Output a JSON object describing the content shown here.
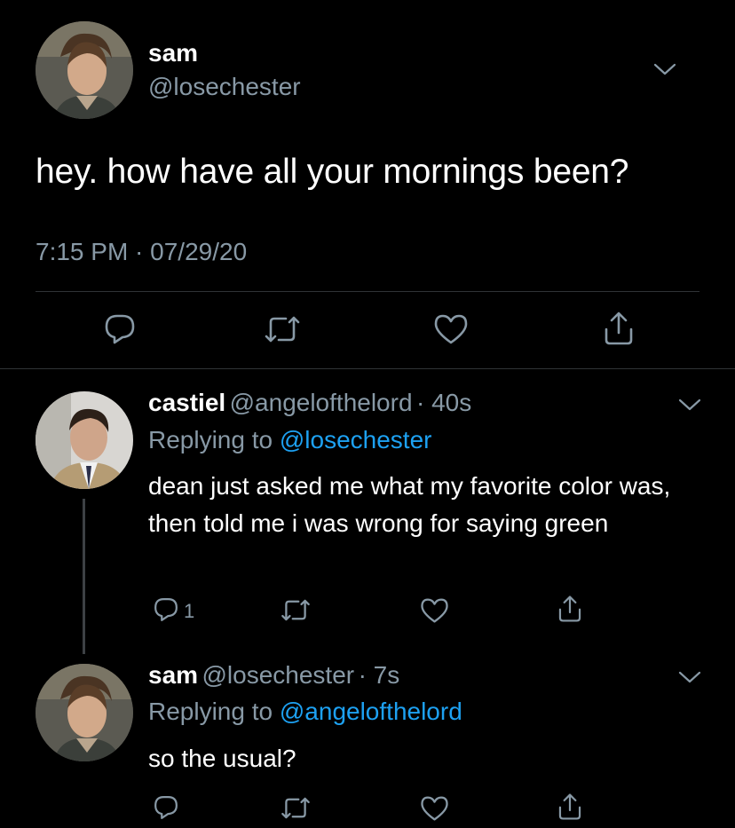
{
  "main_tweet": {
    "name": "sam",
    "handle": "@losechester",
    "text": "hey. how have all your mornings been?",
    "timestamp": "7:15 PM · 07/29/20",
    "avatar_icon": "avatar-sam"
  },
  "replies": [
    {
      "name": "castiel",
      "handle": "@angelofthelord",
      "age": "· 40s",
      "replying_prefix": "Replying to",
      "replying_to": "@losechester",
      "text": "dean just asked me what my favorite color was, then told me i was wrong for saying green",
      "reply_count": "1"
    },
    {
      "name": "sam",
      "handle": "@losechester",
      "age": "· 7s",
      "replying_prefix": "Replying to",
      "replying_to": "@angelofthelord",
      "text": "so the usual?",
      "reply_count": ""
    }
  ],
  "colors": {
    "background": "#000000",
    "secondary_text": "#8899a6",
    "link": "#1da1f2",
    "divider": "#2f3336"
  },
  "icons": [
    "reply-icon",
    "retweet-icon",
    "like-icon",
    "share-icon",
    "chevron-down-icon"
  ]
}
